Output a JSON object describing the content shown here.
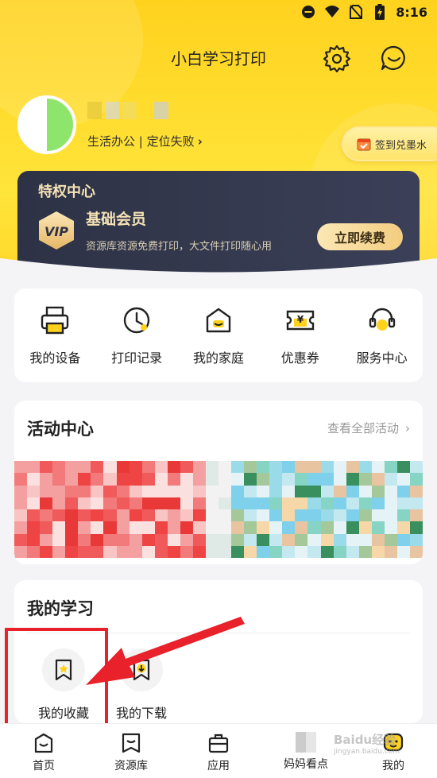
{
  "status_bar": {
    "time": "8:16"
  },
  "header": {
    "title": "小白学习打印"
  },
  "profile": {
    "location_text": "生活办公 | 定位失败",
    "sign_in_label": "签到兑墨水"
  },
  "vip": {
    "center_title": "特权中心",
    "level": "基础会员",
    "badge_text": "VIP",
    "description": "资源库资源免费打印，大文件打印随心用",
    "renew_label": "立即续费"
  },
  "tools": [
    {
      "label": "我的设备",
      "icon": "printer-icon"
    },
    {
      "label": "打印记录",
      "icon": "clock-icon"
    },
    {
      "label": "我的家庭",
      "icon": "home-icon"
    },
    {
      "label": "优惠券",
      "icon": "coupon-icon"
    },
    {
      "label": "服务中心",
      "icon": "headset-icon"
    }
  ],
  "activity": {
    "title": "活动中心",
    "more_label": "查看全部活动"
  },
  "learning": {
    "title": "我的学习",
    "items": [
      {
        "label": "我的收藏",
        "icon": "bookmark-star-icon"
      },
      {
        "label": "我的下载",
        "icon": "download-icon"
      }
    ]
  },
  "tabbar": [
    {
      "label": "首页",
      "icon": "home-tab-icon"
    },
    {
      "label": "资源库",
      "icon": "library-tab-icon"
    },
    {
      "label": "应用",
      "icon": "briefcase-tab-icon"
    },
    {
      "label": "妈妈看点",
      "icon": "mosaic-image"
    },
    {
      "label": "我的",
      "icon": "smile-tab-icon"
    }
  ],
  "watermark": {
    "text": "Baidu经验",
    "sub": "jingyan.baidu.com"
  },
  "colors": {
    "brand_yellow": "#ffd21e",
    "vip_dark": "#2d3245",
    "highlight_red": "#e8212b"
  }
}
